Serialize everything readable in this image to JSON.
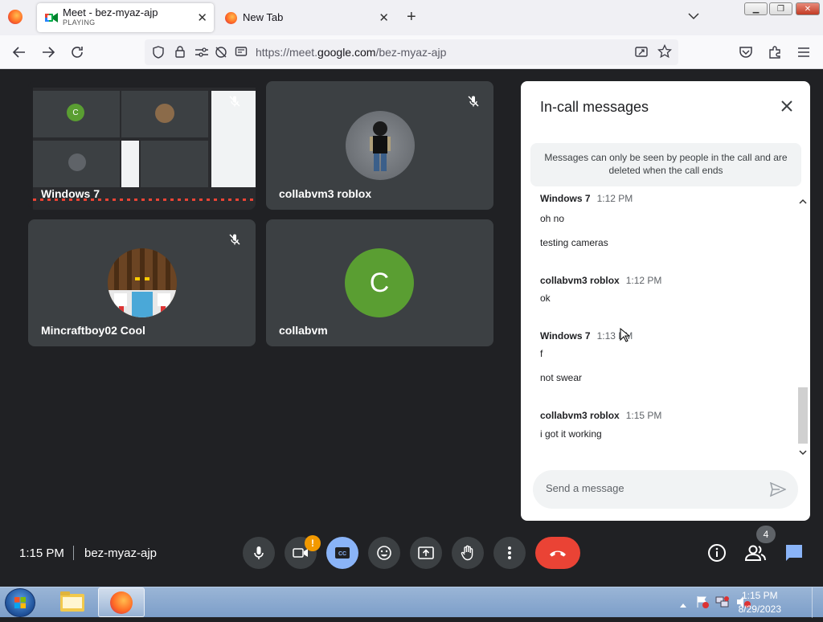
{
  "browser": {
    "tabs": [
      {
        "title": "Meet - bez-myaz-ajp",
        "subtitle": "PLAYING",
        "icon": "google-meet-icon"
      },
      {
        "title": "New Tab",
        "icon": "firefox-icon"
      }
    ],
    "url_prefix": "https://meet.",
    "url_domain": "google.com",
    "url_path": "/bez-myaz-ajp"
  },
  "meet": {
    "tiles": [
      {
        "name": "Windows 7",
        "mic_muted": true
      },
      {
        "name": "collabvm3 roblox",
        "mic_muted": true
      },
      {
        "name": "Mincraftboy02 Cool",
        "mic_muted": true
      },
      {
        "name": "collabvm",
        "avatar_letter": "C",
        "avatar_color": "#5a9e32"
      }
    ],
    "shared_screen_avatar_letter": "C",
    "time": "1:15 PM",
    "meeting_code": "bez-myaz-ajp",
    "people_count": "4",
    "camera_alert": "!"
  },
  "chat": {
    "title": "In-call messages",
    "notice": "Messages can only be seen by people in the call and are deleted when the call ends",
    "messages": [
      {
        "sender": "Windows 7",
        "time": "1:12 PM",
        "lines": [
          "oh no",
          "testing cameras"
        ]
      },
      {
        "sender": "collabvm3 roblox",
        "time": "1:12 PM",
        "lines": [
          "ok"
        ]
      },
      {
        "sender": "Windows 7",
        "time": "1:13 PM",
        "lines": [
          "f",
          "not swear"
        ]
      },
      {
        "sender": "collabvm3 roblox",
        "time": "1:15 PM",
        "lines": [
          "i got it working"
        ]
      }
    ],
    "input_placeholder": "Send a message"
  },
  "taskbar": {
    "time": "1:15 PM",
    "date": "8/29/2023"
  },
  "colors": {
    "meet_bg": "#202124",
    "tile_bg": "#3c4043",
    "end_call": "#ea4335",
    "captions_on": "#8ab4f8",
    "chat_active": "#8ab4f8",
    "alert": "#f29900"
  }
}
